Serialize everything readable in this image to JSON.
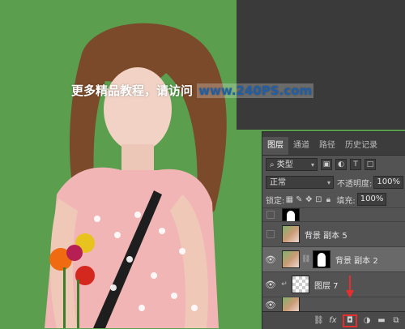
{
  "overlay": {
    "text_cn": "更多精品教程，请访问",
    "text_url": "www.240PS.com"
  },
  "panel": {
    "tabs": [
      "图层",
      "通道",
      "路径",
      "历史记录"
    ],
    "filter": {
      "label": "类型"
    },
    "blend": {
      "mode": "正常",
      "opacity_label": "不透明度:",
      "opacity_value": "100%"
    },
    "lock": {
      "label": "锁定:",
      "fill_label": "填充:",
      "fill_value": "100%"
    },
    "layers": [
      {
        "name": "背景 副本 5",
        "visible": false,
        "selected": false
      },
      {
        "name": "背景 副本 2",
        "visible": true,
        "selected": true
      },
      {
        "name": "图层 7",
        "visible": true,
        "selected": false
      }
    ]
  },
  "icons": {
    "eye": "eye-icon",
    "chain": "chain-link-icon",
    "fx": "fx-icon",
    "mask": "add-mask-icon",
    "adjust": "adjustment-icon",
    "group": "folder-icon",
    "new": "new-layer-icon",
    "arrow": "red-arrow-icon"
  },
  "colors": {
    "background_green": "#5a9e4e",
    "panel_bg": "#535353",
    "highlight_red": "#e52e2e",
    "url_blue": "#1f5fa8"
  }
}
